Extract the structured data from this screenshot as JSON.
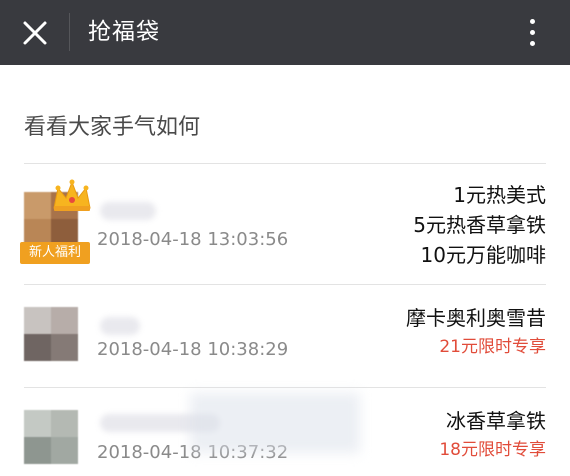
{
  "header": {
    "title": "抢福袋",
    "close_icon": "close-icon",
    "more_icon": "more-vertical-icon"
  },
  "section": {
    "title": "看看大家手气如何"
  },
  "records": [
    {
      "badge": "新人福利",
      "time": "2018-04-18 13:03:56",
      "items": [
        "1元热美式",
        "5元热香草拿铁",
        "10元万能咖啡"
      ],
      "promo": ""
    },
    {
      "badge": "",
      "time": "2018-04-18 10:38:29",
      "items": [
        "摩卡奥利奥雪昔"
      ],
      "promo": "21元限时专享"
    },
    {
      "badge": "",
      "time": "2018-04-18 10:37:32",
      "items": [
        "冰香草拿铁"
      ],
      "promo": "18元限时专享"
    }
  ],
  "colors": {
    "header_bg": "#393a3f",
    "promo_red": "#e14c3a",
    "badge_orange": "#f0a020"
  }
}
